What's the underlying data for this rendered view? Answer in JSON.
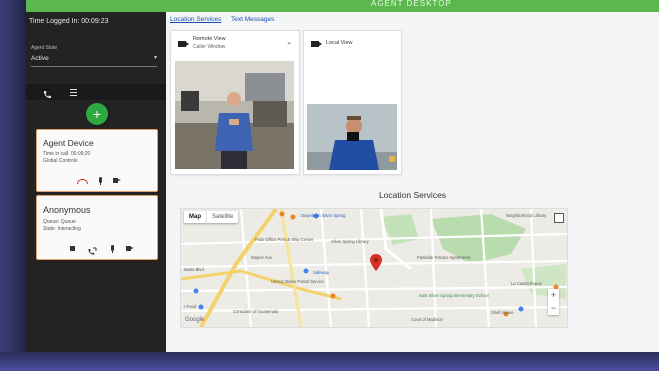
{
  "app": {
    "title": "AGENT DESKTOP",
    "accent": "#5bb84f"
  },
  "left_panel": {
    "login_time": "Time Logged In: 00:09:23",
    "agent_state_label": "Agent State",
    "agent_state_value": "Active",
    "tabs": [
      {
        "icon": "phone-icon"
      },
      {
        "icon": "list-icon"
      }
    ],
    "add_button_label": "+"
  },
  "calls": [
    {
      "title": "Agent Device",
      "time_in_call": "Time in call: 00:09:20",
      "sub": "Global Controls",
      "actions": [
        "hangup-icon",
        "microphone-icon",
        "video-icon"
      ]
    },
    {
      "title": "Anonymous",
      "queue": "Queue: Queue",
      "state": "State: Interacting",
      "actions": [
        "stop-icon",
        "transfer-call-icon",
        "microphone-icon",
        "video-icon"
      ]
    }
  ],
  "main": {
    "tabs": [
      "Location Services",
      "Text Messages"
    ],
    "remote_view": {
      "title": "Remote View",
      "subtitle": "Caller Window"
    },
    "local_view": {
      "title": "Local View"
    },
    "location_title": "Location Services",
    "map": {
      "toggle": [
        "Map",
        "Satellite"
      ],
      "zoom_in": "+",
      "zoom_out": "−",
      "logo": "Google",
      "labels": [
        "Downtown Silver Spring",
        "Fedx Office Print & Ship Center",
        "Silver Spring Library",
        "Wayne Ave",
        "Safeway",
        "United States Postal Service",
        "Parkside Terrace Apartments",
        "East Silver Spring Elementary School",
        "Consulate of Guatemala",
        "Neighborhood Library",
        "La Casita Pupus",
        "Shell House",
        "Court of Madison",
        "Mario Blvd",
        "r Food"
      ]
    }
  }
}
